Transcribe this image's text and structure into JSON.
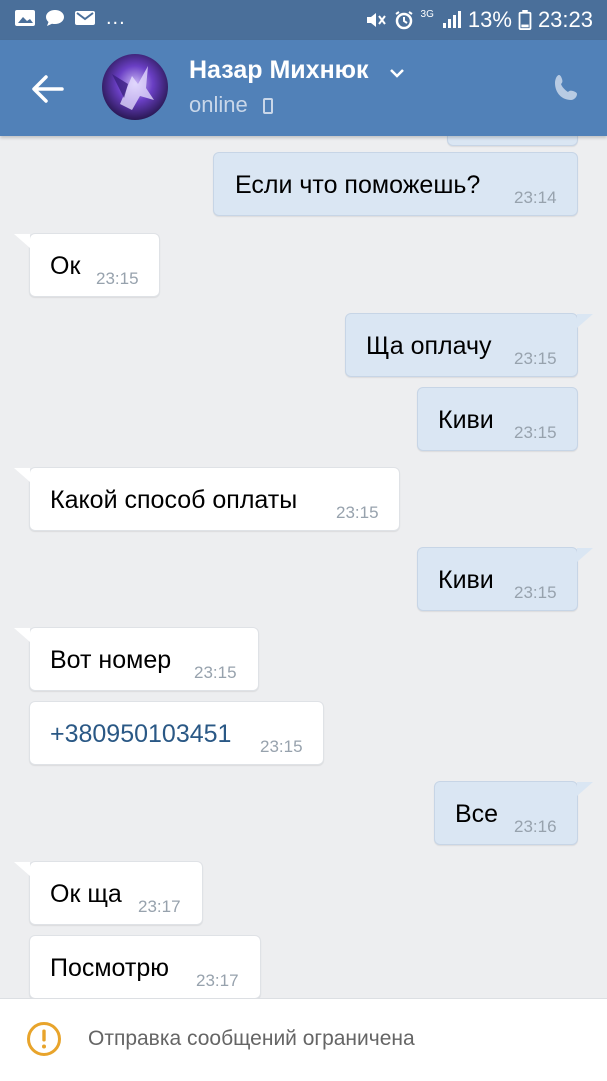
{
  "status_bar": {
    "network": "3G",
    "battery": "13%",
    "time": "23:23",
    "overflow": "..."
  },
  "header": {
    "name": "Назар Михнюк",
    "status": "online"
  },
  "messages": [
    {
      "side": "out",
      "text": "Если что поможешь?",
      "time": "23:14"
    },
    {
      "side": "in",
      "text": "Ок",
      "time": "23:15"
    },
    {
      "side": "out",
      "text": "Ща оплачу",
      "time": "23:15"
    },
    {
      "side": "out",
      "text": "Киви",
      "time": "23:15"
    },
    {
      "side": "in",
      "text": "Какой способ оплаты",
      "time": "23:15"
    },
    {
      "side": "out",
      "text": "Киви",
      "time": "23:15"
    },
    {
      "side": "in",
      "text": "Вот номер",
      "time": "23:15"
    },
    {
      "side": "in",
      "text": "+380950103451",
      "time": "23:15"
    },
    {
      "side": "out",
      "text": "Все",
      "time": "23:16"
    },
    {
      "side": "in",
      "text": "Ок ща",
      "time": "23:17"
    },
    {
      "side": "in",
      "text": "Посмотрю",
      "time": "23:17"
    }
  ],
  "footer": {
    "notice": "Отправка сообщений ограничена"
  },
  "colors": {
    "header": "#5181b8",
    "status_bar": "#4a6f9a",
    "outgoing_bubble": "#dae6f3",
    "incoming_bubble": "#ffffff",
    "link": "#2a5885",
    "warning": "#e8a42b"
  }
}
